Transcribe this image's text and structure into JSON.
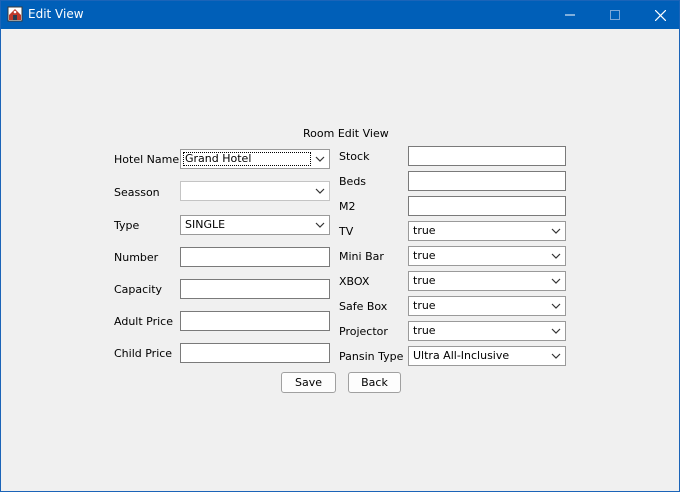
{
  "window": {
    "title": "Edit View"
  },
  "titlebar": {
    "icons": {
      "app": "app-icon",
      "minimize": "minimize-icon",
      "maximize": "maximize-icon",
      "close": "close-icon"
    }
  },
  "form": {
    "heading": "Room Edit View",
    "left": {
      "hotel_name": {
        "label": "Hotel Name",
        "value": "Grand Hotel"
      },
      "season": {
        "label": "Seasson",
        "value": ""
      },
      "type": {
        "label": "Type",
        "value": "SINGLE"
      },
      "number": {
        "label": "Number",
        "value": ""
      },
      "capacity": {
        "label": "Capacity",
        "value": ""
      },
      "adult_price": {
        "label": "Adult Price",
        "value": ""
      },
      "child_price": {
        "label": "Child Price",
        "value": ""
      }
    },
    "right": {
      "stock": {
        "label": "Stock",
        "value": ""
      },
      "beds": {
        "label": "Beds",
        "value": ""
      },
      "m2": {
        "label": "M2",
        "value": ""
      },
      "tv": {
        "label": "TV",
        "value": "true"
      },
      "mini_bar": {
        "label": "Mini Bar",
        "value": "true"
      },
      "xbox": {
        "label": "XBOX",
        "value": "true"
      },
      "safe_box": {
        "label": "Safe Box",
        "value": "true"
      },
      "projector": {
        "label": "Projector",
        "value": "true"
      },
      "pansion_type": {
        "label": "Pansin Type",
        "value": "Ultra All-Inclusive"
      }
    },
    "buttons": {
      "save": "Save",
      "back": "Back"
    }
  }
}
